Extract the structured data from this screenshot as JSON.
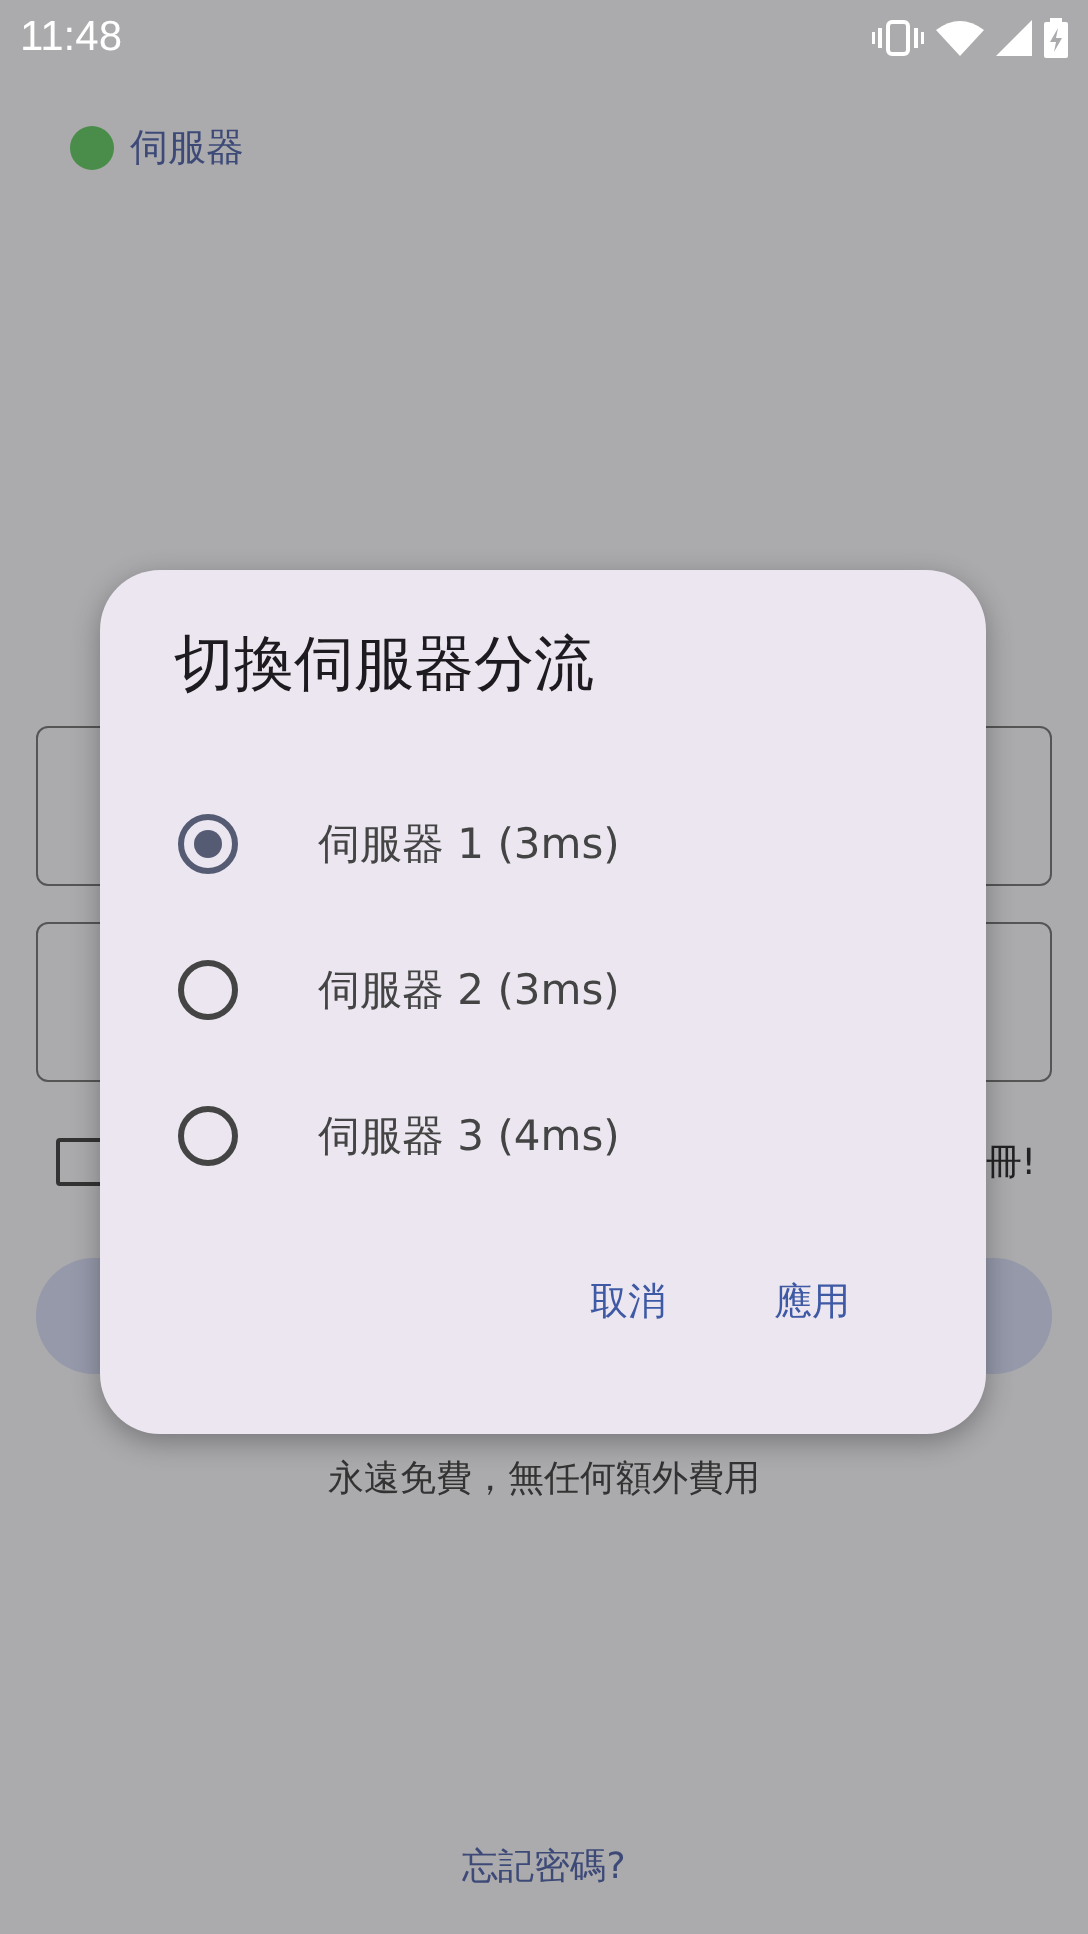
{
  "status_bar": {
    "time": "11:48"
  },
  "server_indicator": {
    "label": "伺服器",
    "color": "#4a8c4a"
  },
  "background_form": {
    "remember_checkbox": {
      "checked": false
    },
    "checkbox_label_fragment": "冊!",
    "footer_note": "永遠免費，無任何額外費用",
    "forgot_password_link": "忘記密碼?"
  },
  "dialog": {
    "title": "切換伺服器分流",
    "options": [
      {
        "label": "伺服器 1 (3ms)",
        "selected": true
      },
      {
        "label": "伺服器 2 (3ms)",
        "selected": false
      },
      {
        "label": "伺服器 3 (4ms)",
        "selected": false
      }
    ],
    "buttons": [
      "取消",
      "應用"
    ]
  }
}
